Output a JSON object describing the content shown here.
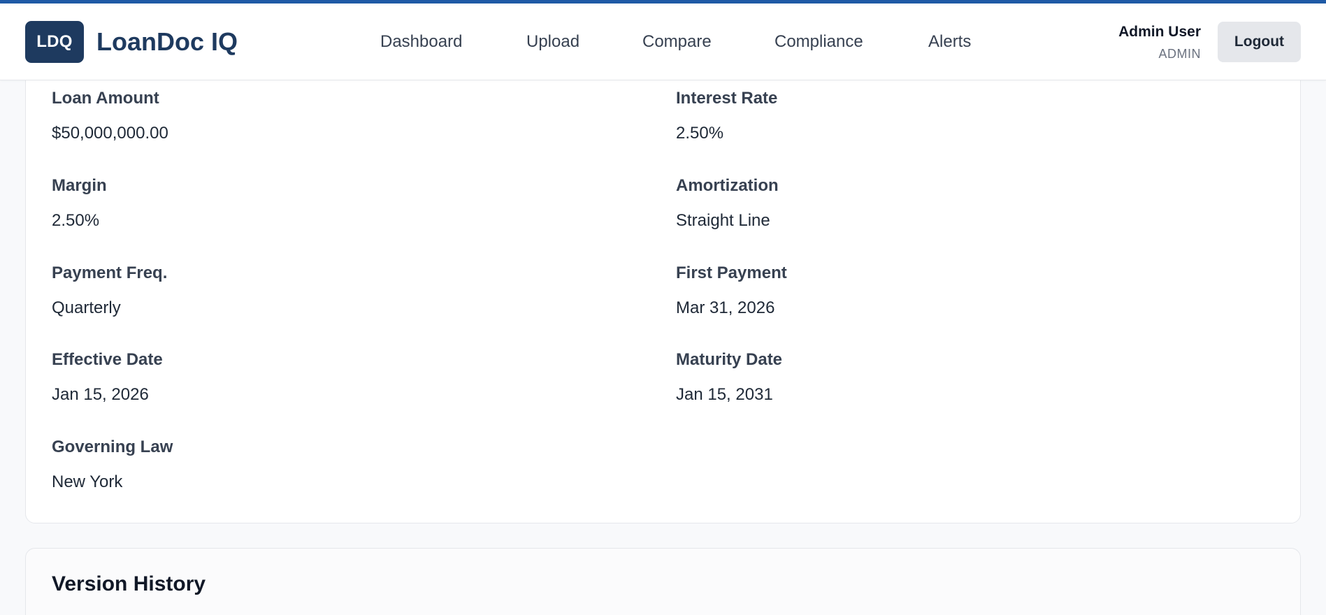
{
  "app": {
    "logo_badge": "LDQ",
    "name": "LoanDoc IQ",
    "accent_color": "#1f5aa6",
    "brand_color": "#1e3a5f"
  },
  "nav": {
    "items": [
      {
        "label": "Dashboard"
      },
      {
        "label": "Upload"
      },
      {
        "label": "Compare"
      },
      {
        "label": "Compliance"
      },
      {
        "label": "Alerts"
      }
    ]
  },
  "user": {
    "name": "Admin User",
    "role": "ADMIN",
    "logout_label": "Logout"
  },
  "loan_details": {
    "fields": [
      {
        "label": "Loan Amount",
        "value": "$50,000,000.00"
      },
      {
        "label": "Interest Rate",
        "value": "2.50%"
      },
      {
        "label": "Margin",
        "value": "2.50%"
      },
      {
        "label": "Amortization",
        "value": "Straight Line"
      },
      {
        "label": "Payment Freq.",
        "value": "Quarterly"
      },
      {
        "label": "First Payment",
        "value": "Mar 31, 2026"
      },
      {
        "label": "Effective Date",
        "value": "Jan 15, 2026"
      },
      {
        "label": "Maturity Date",
        "value": "Jan 15, 2031"
      },
      {
        "label": "Governing Law",
        "value": "New York"
      }
    ]
  },
  "version_history": {
    "title": "Version History"
  }
}
